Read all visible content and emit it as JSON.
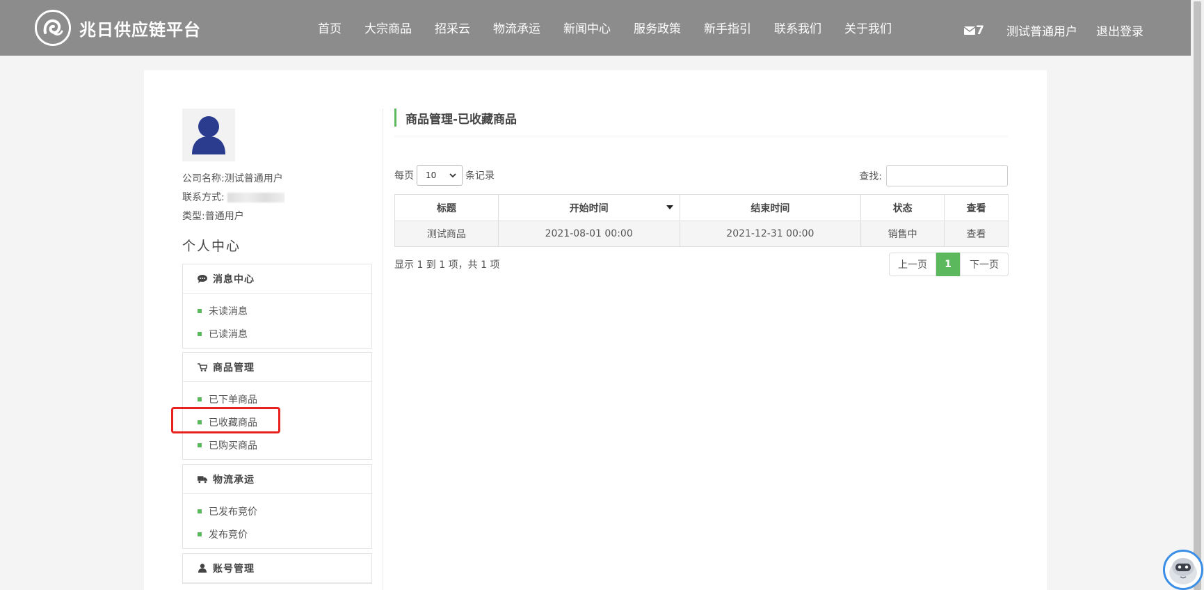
{
  "header": {
    "brand": "兆日供应链平台",
    "nav": [
      "首页",
      "大宗商品",
      "招采云",
      "物流承运",
      "新闻中心",
      "服务政策",
      "新手指引",
      "联系我们",
      "关于我们"
    ],
    "mail_count": "7",
    "username": "测试普通用户",
    "logout": "退出登录"
  },
  "profile": {
    "company_label": "公司名称:",
    "company_value": "测试普通用户",
    "contact_label": "联系方式:",
    "type_label": "类型:",
    "type_value": "普通用户"
  },
  "sidebar": {
    "title": "个人中心",
    "groups": [
      {
        "title": "消息中心",
        "icon": "comment-icon",
        "items": [
          "未读消息",
          "已读消息"
        ]
      },
      {
        "title": "商品管理",
        "icon": "cart-icon",
        "items": [
          "已下单商品",
          "已收藏商品",
          "已购买商品"
        ]
      },
      {
        "title": "物流承运",
        "icon": "truck-icon",
        "items": [
          "已发布竞价",
          "发布竞价"
        ]
      },
      {
        "title": "账号管理",
        "icon": "user-icon",
        "items": []
      }
    ]
  },
  "main": {
    "title": "商品管理-已收藏商品",
    "perpage_prefix": "每页",
    "perpage_value": "10",
    "perpage_suffix": "条记录",
    "search_label": "查找:",
    "table": {
      "headers": [
        "标题",
        "开始时间",
        "结束时间",
        "状态",
        "查看"
      ],
      "rows": [
        [
          "测试商品",
          "2021-08-01 00:00",
          "2021-12-31 00:00",
          "销售中",
          "查看"
        ]
      ]
    },
    "summary": "显示 1 到 1 项，共 1 项",
    "pager": {
      "prev": "上一页",
      "current": "1",
      "next": "下一页"
    }
  },
  "colors": {
    "header_bg": "#8c8c8c",
    "accent": "#5cb85c",
    "highlight": "#e8211f"
  }
}
